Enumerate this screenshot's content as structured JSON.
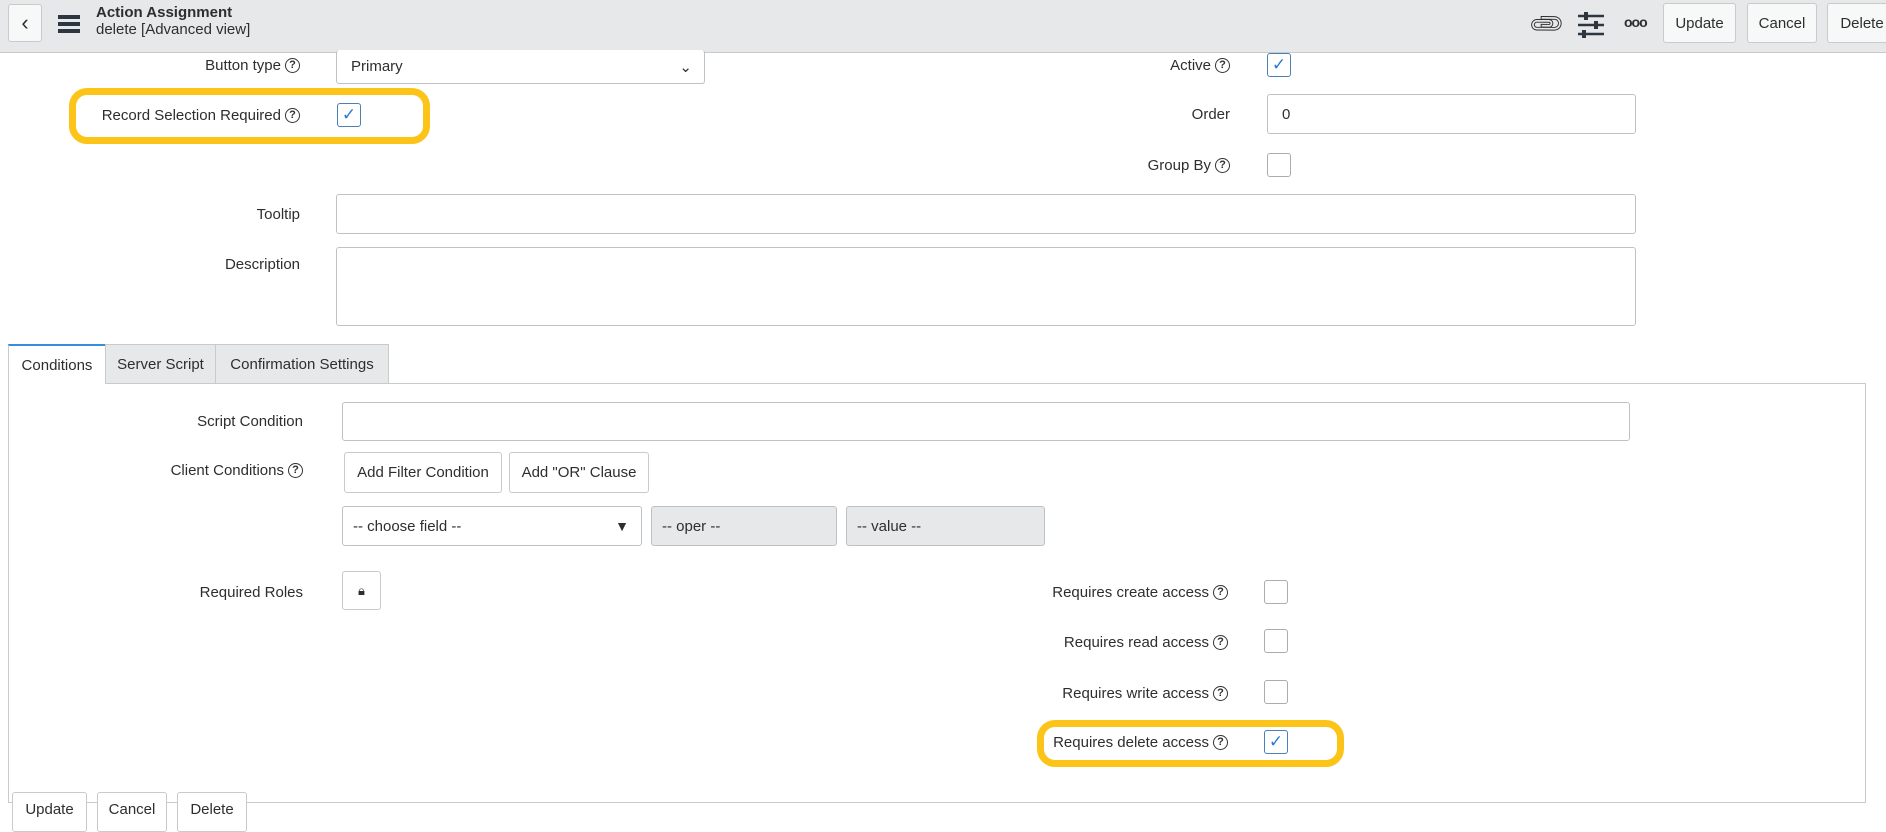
{
  "header": {
    "title": "Action Assignment",
    "subtitle": "delete [Advanced view]",
    "buttons": {
      "update": "Update",
      "cancel": "Cancel",
      "delete": "Delete"
    },
    "icons": [
      "back-icon",
      "menu-icon",
      "paperclip-icon",
      "sliders-icon",
      "more-icon"
    ]
  },
  "form": {
    "button_type": {
      "label": "Button type",
      "value": "Primary"
    },
    "record_selection_required": {
      "label": "Record Selection Required",
      "checked": true
    },
    "active": {
      "label": "Active",
      "checked": true
    },
    "order": {
      "label": "Order",
      "value": "0"
    },
    "group_by": {
      "label": "Group By",
      "checked": false
    },
    "tooltip": {
      "label": "Tooltip",
      "value": ""
    },
    "description": {
      "label": "Description",
      "value": ""
    }
  },
  "tabs": [
    {
      "label": "Conditions",
      "active": true
    },
    {
      "label": "Server Script"
    },
    {
      "label": "Confirmation Settings"
    }
  ],
  "conditions": {
    "script_condition": {
      "label": "Script Condition",
      "value": ""
    },
    "client_conditions": {
      "label": "Client Conditions",
      "add_filter": "Add Filter Condition",
      "add_or": "Add \"OR\" Clause",
      "field": "-- choose field --",
      "oper": "-- oper --",
      "value": "-- value --"
    },
    "required_roles": {
      "label": "Required Roles"
    },
    "requires_create": {
      "label": "Requires create access",
      "checked": false
    },
    "requires_read": {
      "label": "Requires read access",
      "checked": false
    },
    "requires_write": {
      "label": "Requires write access",
      "checked": false
    },
    "requires_delete": {
      "label": "Requires delete access",
      "checked": true
    }
  },
  "footer": {
    "update": "Update",
    "cancel": "Cancel",
    "delete": "Delete"
  },
  "colors": {
    "highlight": "#fcc419",
    "accent": "#2a7bd0"
  }
}
